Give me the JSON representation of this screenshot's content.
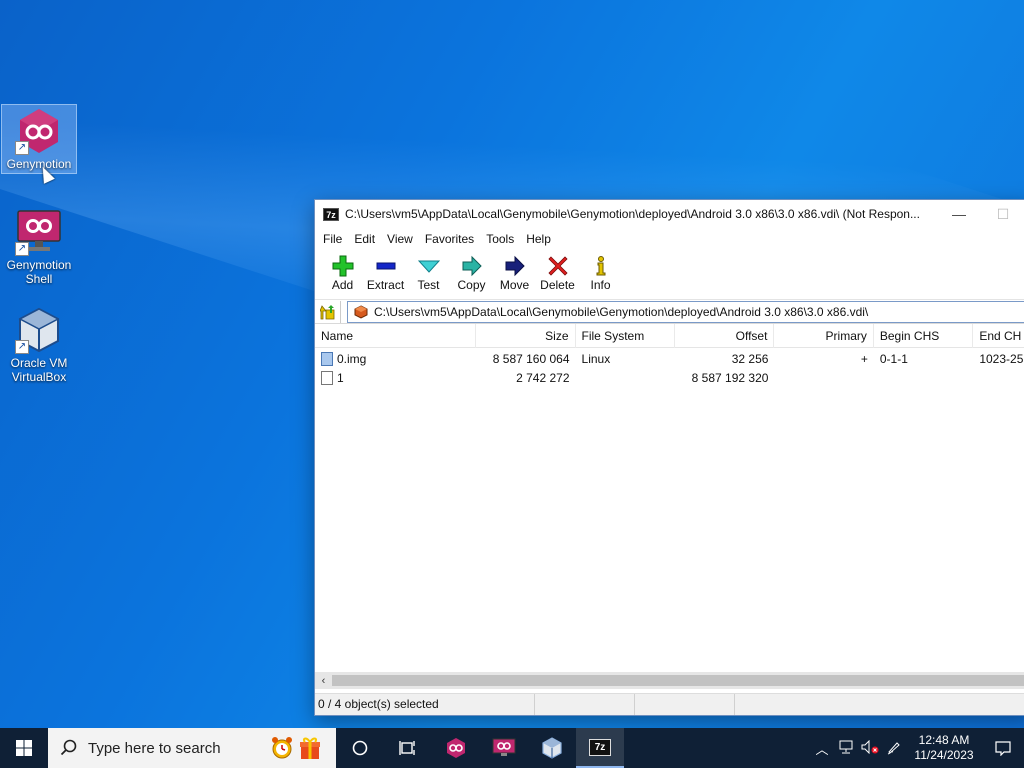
{
  "desktop": {
    "icons": [
      {
        "label": "Genymotion"
      },
      {
        "label": "Genymotion Shell"
      },
      {
        "label": "Oracle VM VirtualBox"
      }
    ]
  },
  "window": {
    "title": "C:\\Users\\vm5\\AppData\\Local\\Genymobile\\Genymotion\\deployed\\Android 3.0 x86\\3.0 x86.vdi\\ (Not Respon...",
    "app_badge": "7z",
    "minimize": "—",
    "maximize": "☐",
    "menu": [
      "File",
      "Edit",
      "View",
      "Favorites",
      "Tools",
      "Help"
    ],
    "toolbar": [
      {
        "label": "Add",
        "icon": "plus-icon"
      },
      {
        "label": "Extract",
        "icon": "minus-icon"
      },
      {
        "label": "Test",
        "icon": "check-icon"
      },
      {
        "label": "Copy",
        "icon": "copy-arrow-icon"
      },
      {
        "label": "Move",
        "icon": "move-arrow-icon"
      },
      {
        "label": "Delete",
        "icon": "x-icon"
      },
      {
        "label": "Info",
        "icon": "info-icon"
      }
    ],
    "address": "C:\\Users\\vm5\\AppData\\Local\\Genymobile\\Genymotion\\deployed\\Android 3.0 x86\\3.0 x86.vdi\\",
    "columns": [
      "Name",
      "Size",
      "File System",
      "Offset",
      "Primary",
      "Begin CHS",
      "End CH"
    ],
    "rows": [
      {
        "name": "0.img",
        "size": "8 587 160 064",
        "fs": "Linux",
        "offset": "32 256",
        "primary": "+",
        "begin_chs": "0-1-1",
        "end_chs": "1023-25"
      },
      {
        "name": "1",
        "size": "2 742 272",
        "fs": "",
        "offset": "8 587 192 320",
        "primary": "",
        "begin_chs": "",
        "end_chs": ""
      }
    ],
    "status": "0 / 4 object(s) selected"
  },
  "taskbar": {
    "search_placeholder": "Type here to search",
    "time": "12:48 AM",
    "date": "11/24/2023"
  },
  "colors": {
    "accent": "#0b74dd",
    "taskbar": "#0f2036",
    "genymotion": "#c0276f"
  }
}
